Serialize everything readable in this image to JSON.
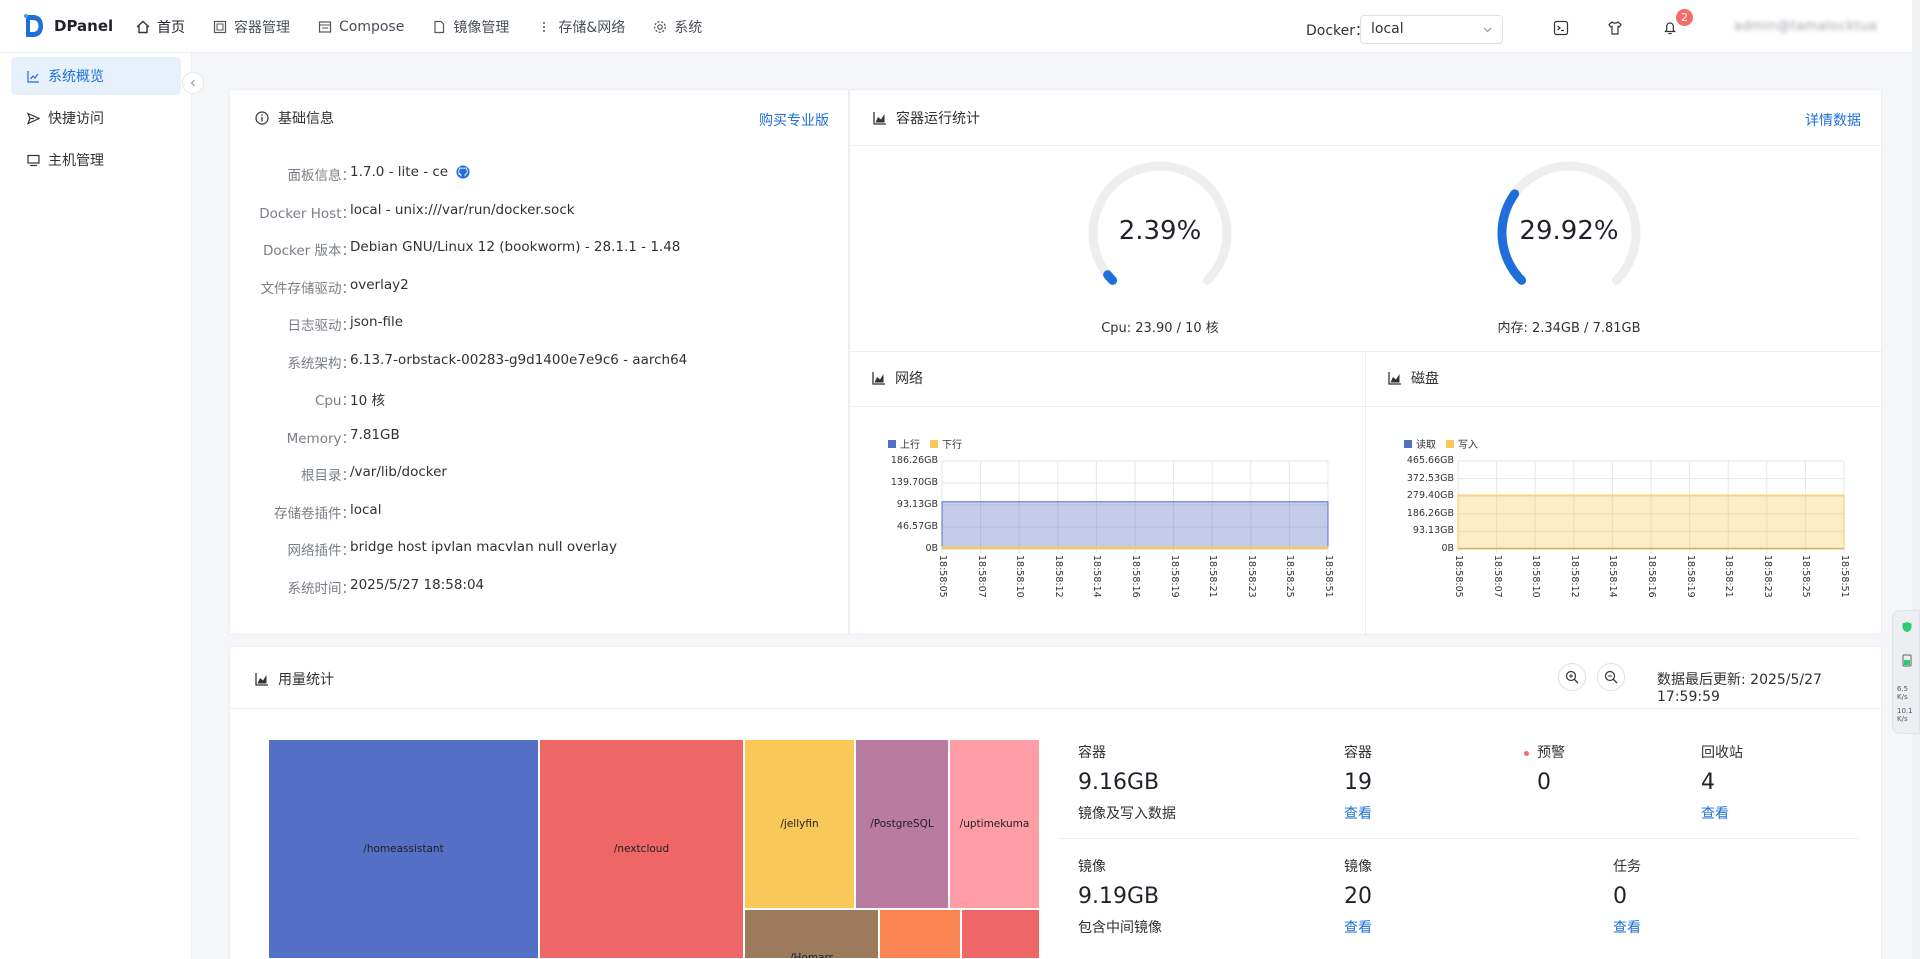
{
  "brand": {
    "name": "DPanel"
  },
  "nav": [
    {
      "label": "首页",
      "icon": "home-icon"
    },
    {
      "label": "容器管理",
      "icon": "container-icon"
    },
    {
      "label": "Compose",
      "icon": "compose-icon"
    },
    {
      "label": "镜像管理",
      "icon": "file-icon"
    },
    {
      "label": "存储&网络",
      "icon": "more-vertical-icon"
    },
    {
      "label": "系统",
      "icon": "gear-icon"
    }
  ],
  "topbar": {
    "docker_label": "Docker：",
    "docker_select_value": "local",
    "notification_count": "2",
    "user_name": "admin@tamalocktua"
  },
  "sidebar": {
    "items": [
      {
        "label": "系统概览",
        "icon": "chart-icon",
        "active": true
      },
      {
        "label": "快捷访问",
        "icon": "send-icon",
        "active": false
      },
      {
        "label": "主机管理",
        "icon": "monitor-icon",
        "active": false
      }
    ]
  },
  "info": {
    "title": "基础信息",
    "buy_link": "购买专业版",
    "rows": [
      {
        "label": "面板信息：",
        "value": "1.7.0 - lite - ce"
      },
      {
        "label": "Docker Host：",
        "value": "local - unix:///var/run/docker.sock"
      },
      {
        "label": "Docker 版本：",
        "value": "Debian GNU/Linux 12 (bookworm) - 28.1.1 - 1.48"
      },
      {
        "label": "文件存储驱动：",
        "value": "overlay2"
      },
      {
        "label": "日志驱动：",
        "value": "json-file"
      },
      {
        "label": "系统架构：",
        "value": "6.13.7-orbstack-00283-g9d1400e7e9c6 - aarch64"
      },
      {
        "label": "Cpu：",
        "value": "10 核"
      },
      {
        "label": "Memory：",
        "value": "7.81GB"
      },
      {
        "label": "根目录：",
        "value": "/var/lib/docker"
      },
      {
        "label": "存储卷插件：",
        "value": "local"
      },
      {
        "label": "网络插件：",
        "value": "bridge  host  ipvlan  macvlan  null  overlay"
      },
      {
        "label": "系统时间：",
        "value": "2025/5/27 18:58:04"
      }
    ]
  },
  "stats": {
    "title": "容器运行统计",
    "detail_link": "详情数据",
    "cpu": {
      "value_text": "2.39%",
      "percent": 2.39,
      "label": "Cpu: 23.90 / 10 核"
    },
    "mem": {
      "value_text": "29.92%",
      "percent": 29.92,
      "label": "内存: 2.34GB / 7.81GB"
    },
    "accent_color": "#1e6fd9"
  },
  "network_chart": {
    "title": "网络",
    "chart_data": {
      "type": "area",
      "x": [
        "18:58:05",
        "18:58:07",
        "18:58:10",
        "18:58:12",
        "18:58:14",
        "18:58:16",
        "18:58:19",
        "18:58:21",
        "18:58:23",
        "18:58:25",
        "18:58:51"
      ],
      "yticks": [
        "186.26GB",
        "139.70GB",
        "93.13GB",
        "46.57GB",
        "0B"
      ],
      "series": [
        {
          "name": "上行",
          "color": "#5470c6",
          "values_gb": [
            100,
            100,
            100,
            100,
            100,
            100,
            100,
            100,
            100,
            100,
            100
          ]
        },
        {
          "name": "下行",
          "color": "#fac858",
          "values_gb": [
            5,
            5,
            5,
            5,
            5,
            5,
            5,
            5,
            5,
            5,
            5
          ]
        }
      ],
      "ylim_gb": [
        0,
        186.26
      ]
    }
  },
  "disk_chart": {
    "title": "磁盘",
    "chart_data": {
      "type": "area",
      "x": [
        "18:58:05",
        "18:58:07",
        "18:58:10",
        "18:58:12",
        "18:58:14",
        "18:58:16",
        "18:58:19",
        "18:58:21",
        "18:58:23",
        "18:58:25",
        "18:58:51"
      ],
      "yticks": [
        "465.66GB",
        "372.53GB",
        "279.40GB",
        "186.26GB",
        "93.13GB",
        "0B"
      ],
      "series": [
        {
          "name": "读取",
          "color": "#5470c6",
          "values_gb": [
            3,
            3,
            3,
            3,
            3,
            3,
            3,
            3,
            3,
            3,
            3
          ]
        },
        {
          "name": "写入",
          "color": "#fac858",
          "values_gb": [
            285,
            285,
            285,
            285,
            285,
            285,
            285,
            285,
            285,
            285,
            285
          ]
        }
      ],
      "ylim_gb": [
        0,
        465.66
      ]
    }
  },
  "usage": {
    "title": "用量统计",
    "last_update": "数据最后更新: 2025/5/27 17:59:59",
    "treemap": [
      {
        "label": "/homeassistant",
        "color": "#5470c6"
      },
      {
        "label": "/nextcloud",
        "color": "#ee6666"
      },
      {
        "label": "/jellyfin",
        "color": "#fac858"
      },
      {
        "label": "/PostgreSQL",
        "color": "#ba7ba1"
      },
      {
        "label": "/uptimekuma",
        "color": "#ff9da7"
      },
      {
        "label": "/Homarr",
        "color": "#9c7a5c"
      },
      {
        "label": "",
        "color": "#fc8452"
      },
      {
        "label": "",
        "color": "#ee6666"
      }
    ],
    "cards": {
      "containers_size": {
        "label": "容器",
        "value": "9.16GB",
        "sub": "镜像及写入数据"
      },
      "containers_count": {
        "label": "容器",
        "value": "19",
        "link": "查看"
      },
      "alerts": {
        "label": "预警",
        "value": "0"
      },
      "recycle": {
        "label": "回收站",
        "value": "4",
        "link": "查看"
      },
      "images_size": {
        "label": "镜像",
        "value": "9.19GB",
        "sub": "包含中间镜像"
      },
      "images_count": {
        "label": "镜像",
        "value": "20",
        "link": "查看"
      },
      "tasks": {
        "label": "任务",
        "value": "0",
        "link": "查看"
      }
    }
  },
  "float_widget": {
    "line1": "6.5",
    "line2": "K/s",
    "line3": "10.1",
    "line4": "K/s"
  }
}
